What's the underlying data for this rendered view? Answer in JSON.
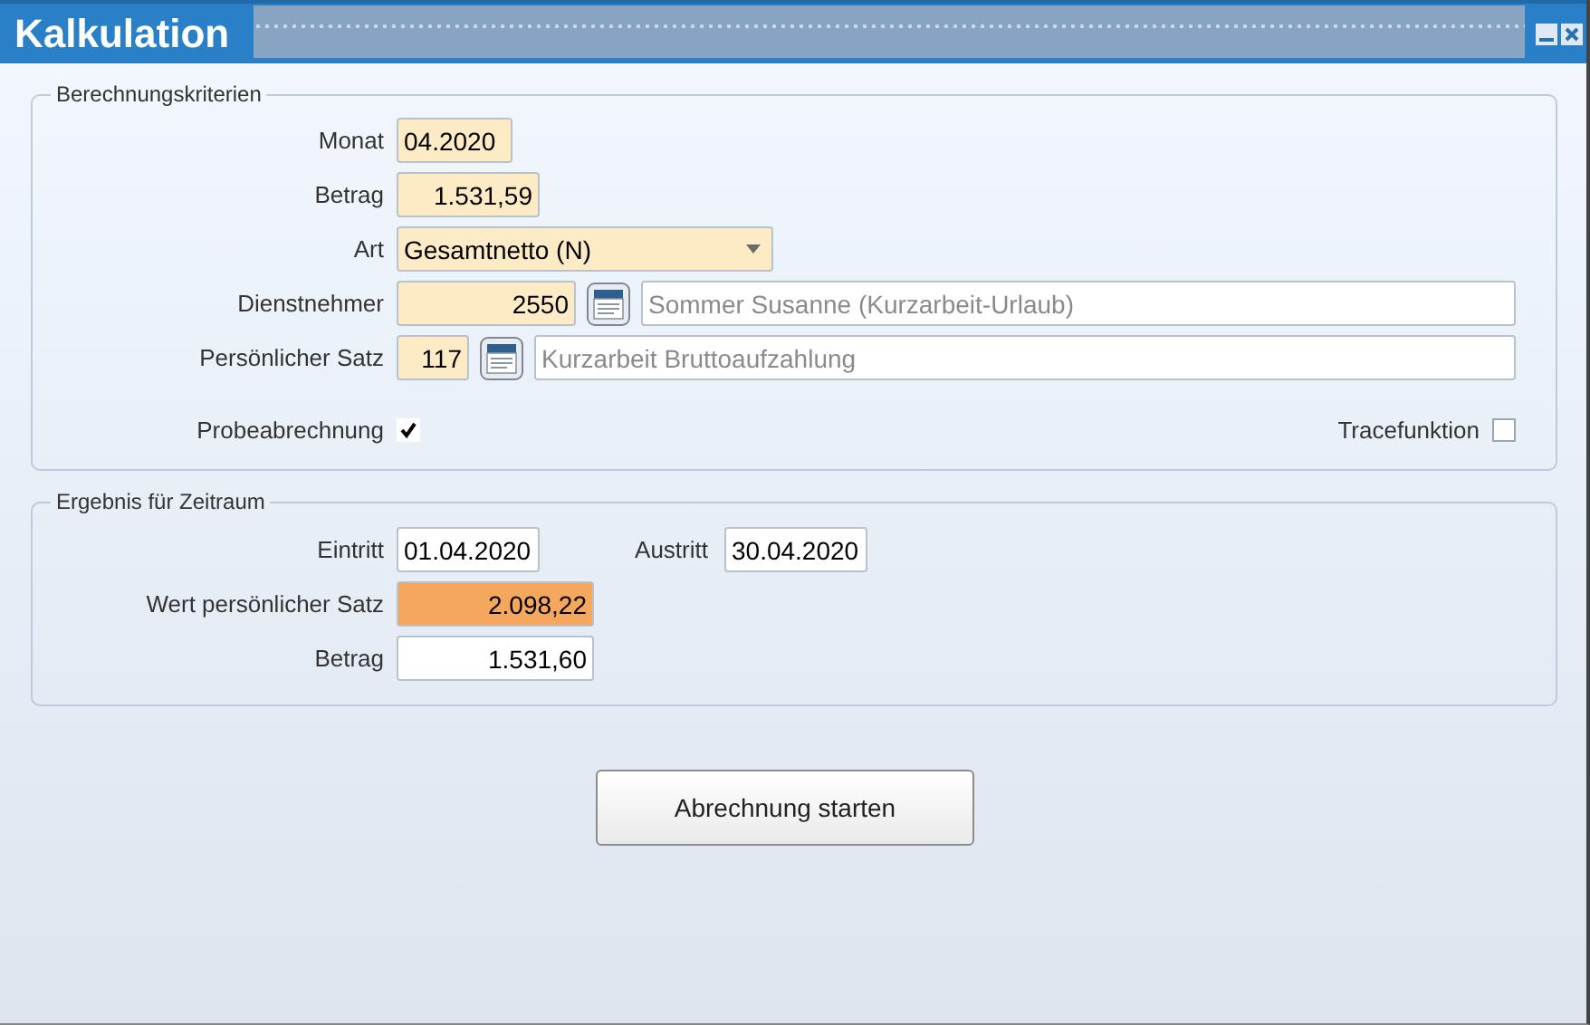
{
  "window": {
    "title": "Kalkulation"
  },
  "criteria": {
    "legend": "Berechnungskriterien",
    "month": {
      "label": "Monat",
      "value": "04.2020"
    },
    "amount": {
      "label": "Betrag",
      "value": "1.531,59"
    },
    "type": {
      "label": "Art",
      "value": "Gesamtnetto (N)"
    },
    "employee": {
      "label": "Dienstnehmer",
      "value": "2550",
      "description": "Sommer Susanne (Kurzarbeit-Urlaub)"
    },
    "rate": {
      "label": "Persönlicher Satz",
      "value": "117",
      "description": "Kurzarbeit Bruttoaufzahlung"
    },
    "trial_run": {
      "label": "Probeabrechnung",
      "checked": true
    },
    "trace": {
      "label": "Tracefunktion",
      "checked": false
    }
  },
  "result": {
    "legend": "Ergebnis für Zeitraum",
    "entry": {
      "label": "Eintritt",
      "value": "01.04.2020"
    },
    "exit": {
      "label": "Austritt",
      "value": "30.04.2020"
    },
    "rate_value": {
      "label": "Wert persönlicher Satz",
      "value": "2.098,22",
      "highlighted": true
    },
    "amount": {
      "label": "Betrag",
      "value": "1.531,60"
    }
  },
  "start_button": "Abrechnung starten"
}
